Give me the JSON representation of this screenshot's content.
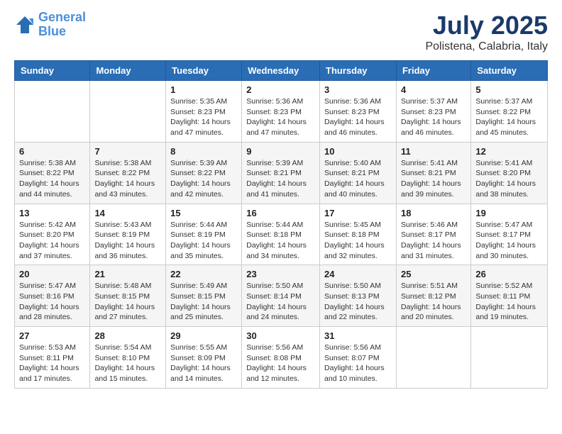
{
  "header": {
    "logo_line1": "General",
    "logo_line2": "Blue",
    "title": "July 2025",
    "subtitle": "Polistena, Calabria, Italy"
  },
  "weekdays": [
    "Sunday",
    "Monday",
    "Tuesday",
    "Wednesday",
    "Thursday",
    "Friday",
    "Saturday"
  ],
  "weeks": [
    [
      {
        "day": "",
        "info": ""
      },
      {
        "day": "",
        "info": ""
      },
      {
        "day": "1",
        "info": "Sunrise: 5:35 AM\nSunset: 8:23 PM\nDaylight: 14 hours and 47 minutes."
      },
      {
        "day": "2",
        "info": "Sunrise: 5:36 AM\nSunset: 8:23 PM\nDaylight: 14 hours and 47 minutes."
      },
      {
        "day": "3",
        "info": "Sunrise: 5:36 AM\nSunset: 8:23 PM\nDaylight: 14 hours and 46 minutes."
      },
      {
        "day": "4",
        "info": "Sunrise: 5:37 AM\nSunset: 8:23 PM\nDaylight: 14 hours and 46 minutes."
      },
      {
        "day": "5",
        "info": "Sunrise: 5:37 AM\nSunset: 8:22 PM\nDaylight: 14 hours and 45 minutes."
      }
    ],
    [
      {
        "day": "6",
        "info": "Sunrise: 5:38 AM\nSunset: 8:22 PM\nDaylight: 14 hours and 44 minutes."
      },
      {
        "day": "7",
        "info": "Sunrise: 5:38 AM\nSunset: 8:22 PM\nDaylight: 14 hours and 43 minutes."
      },
      {
        "day": "8",
        "info": "Sunrise: 5:39 AM\nSunset: 8:22 PM\nDaylight: 14 hours and 42 minutes."
      },
      {
        "day": "9",
        "info": "Sunrise: 5:39 AM\nSunset: 8:21 PM\nDaylight: 14 hours and 41 minutes."
      },
      {
        "day": "10",
        "info": "Sunrise: 5:40 AM\nSunset: 8:21 PM\nDaylight: 14 hours and 40 minutes."
      },
      {
        "day": "11",
        "info": "Sunrise: 5:41 AM\nSunset: 8:21 PM\nDaylight: 14 hours and 39 minutes."
      },
      {
        "day": "12",
        "info": "Sunrise: 5:41 AM\nSunset: 8:20 PM\nDaylight: 14 hours and 38 minutes."
      }
    ],
    [
      {
        "day": "13",
        "info": "Sunrise: 5:42 AM\nSunset: 8:20 PM\nDaylight: 14 hours and 37 minutes."
      },
      {
        "day": "14",
        "info": "Sunrise: 5:43 AM\nSunset: 8:19 PM\nDaylight: 14 hours and 36 minutes."
      },
      {
        "day": "15",
        "info": "Sunrise: 5:44 AM\nSunset: 8:19 PM\nDaylight: 14 hours and 35 minutes."
      },
      {
        "day": "16",
        "info": "Sunrise: 5:44 AM\nSunset: 8:18 PM\nDaylight: 14 hours and 34 minutes."
      },
      {
        "day": "17",
        "info": "Sunrise: 5:45 AM\nSunset: 8:18 PM\nDaylight: 14 hours and 32 minutes."
      },
      {
        "day": "18",
        "info": "Sunrise: 5:46 AM\nSunset: 8:17 PM\nDaylight: 14 hours and 31 minutes."
      },
      {
        "day": "19",
        "info": "Sunrise: 5:47 AM\nSunset: 8:17 PM\nDaylight: 14 hours and 30 minutes."
      }
    ],
    [
      {
        "day": "20",
        "info": "Sunrise: 5:47 AM\nSunset: 8:16 PM\nDaylight: 14 hours and 28 minutes."
      },
      {
        "day": "21",
        "info": "Sunrise: 5:48 AM\nSunset: 8:15 PM\nDaylight: 14 hours and 27 minutes."
      },
      {
        "day": "22",
        "info": "Sunrise: 5:49 AM\nSunset: 8:15 PM\nDaylight: 14 hours and 25 minutes."
      },
      {
        "day": "23",
        "info": "Sunrise: 5:50 AM\nSunset: 8:14 PM\nDaylight: 14 hours and 24 minutes."
      },
      {
        "day": "24",
        "info": "Sunrise: 5:50 AM\nSunset: 8:13 PM\nDaylight: 14 hours and 22 minutes."
      },
      {
        "day": "25",
        "info": "Sunrise: 5:51 AM\nSunset: 8:12 PM\nDaylight: 14 hours and 20 minutes."
      },
      {
        "day": "26",
        "info": "Sunrise: 5:52 AM\nSunset: 8:11 PM\nDaylight: 14 hours and 19 minutes."
      }
    ],
    [
      {
        "day": "27",
        "info": "Sunrise: 5:53 AM\nSunset: 8:11 PM\nDaylight: 14 hours and 17 minutes."
      },
      {
        "day": "28",
        "info": "Sunrise: 5:54 AM\nSunset: 8:10 PM\nDaylight: 14 hours and 15 minutes."
      },
      {
        "day": "29",
        "info": "Sunrise: 5:55 AM\nSunset: 8:09 PM\nDaylight: 14 hours and 14 minutes."
      },
      {
        "day": "30",
        "info": "Sunrise: 5:56 AM\nSunset: 8:08 PM\nDaylight: 14 hours and 12 minutes."
      },
      {
        "day": "31",
        "info": "Sunrise: 5:56 AM\nSunset: 8:07 PM\nDaylight: 14 hours and 10 minutes."
      },
      {
        "day": "",
        "info": ""
      },
      {
        "day": "",
        "info": ""
      }
    ]
  ]
}
